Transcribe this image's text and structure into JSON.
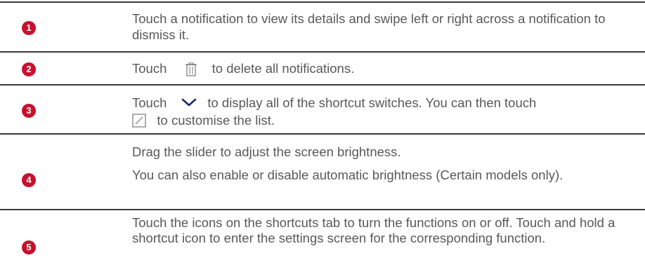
{
  "rows": [
    {
      "number": "1",
      "text": "Touch a notification to view its details and swipe left or right across a notification to dismiss it."
    },
    {
      "number": "2",
      "text_before": "Touch",
      "icon": "trash-icon",
      "text_after": "to delete all notifications."
    },
    {
      "number": "3",
      "text_before": "Touch",
      "icon": "chevron-down-icon",
      "text_middle": "to display all of the shortcut switches. You can then touch",
      "icon2": "edit-icon",
      "text_after": "to customise the list."
    },
    {
      "number": "4",
      "paragraph_1": "Drag the slider to adjust the screen brightness.",
      "paragraph_2": "You can also enable or disable automatic brightness  (Certain models only)."
    },
    {
      "number": "5",
      "text": "Touch the icons on the shortcuts tab to turn the functions on or off. Touch and hold a shortcut icon to enter the settings screen for the corresponding function."
    }
  ],
  "colors": {
    "badge": "#c8102e",
    "text": "#595959",
    "divider": "#3a3a3a"
  }
}
